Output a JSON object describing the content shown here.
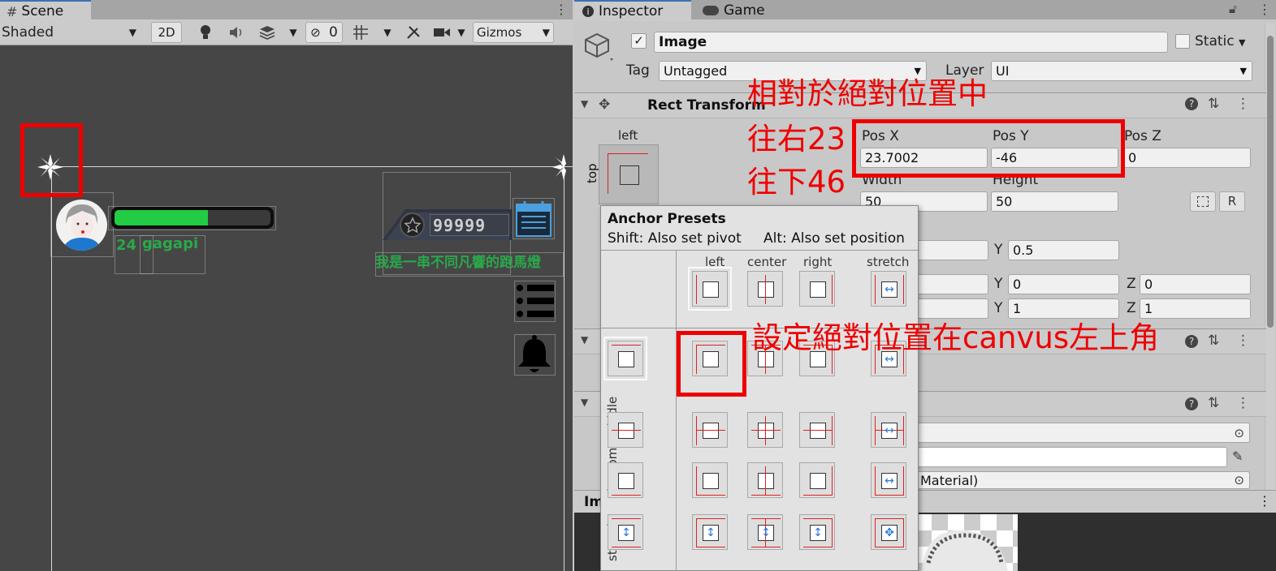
{
  "scene": {
    "tab_label": "Scene",
    "shading_mode": "Shaded",
    "mode_2d": "2D",
    "hidden_count": "0",
    "gizmos_label": "Gizmos",
    "hud": {
      "level": "24",
      "username": "gagapi",
      "coins": "99999",
      "marquee": "我是一串不同凡響的跑馬燈",
      "health_fraction": 0.6
    },
    "icons": [
      "grid-icon",
      "light-bulb-icon",
      "audio-icon",
      "effects-icon",
      "visibility-icon",
      "grid-snap-icon",
      "tools-icon",
      "camera-icon",
      "avatar",
      "star-icon",
      "calendar-icon",
      "list-icon",
      "bell-icon"
    ]
  },
  "inspector": {
    "tab_label": "Inspector",
    "game_tab_label": "Game",
    "object_name": "Image",
    "static_label": "Static",
    "tag_label": "Tag",
    "tag_value": "Untagged",
    "layer_label": "Layer",
    "layer_value": "UI",
    "rect_transform_title": "Rect Transform",
    "anchor_h": "left",
    "anchor_v": "top",
    "pos_x_label": "Pos X",
    "pos_y_label": "Pos Y",
    "pos_z_label": "Pos Z",
    "pos_x": "23.7002",
    "pos_y": "-46",
    "pos_z": "0",
    "width_label": "Width",
    "height_label": "Height",
    "width": "50",
    "height": "50",
    "raw_edit_label": "R",
    "pivot_y_label": "Y",
    "pivot_y": "0.5",
    "rot_y_label": "Y",
    "rot_y": "0",
    "rot_z_label": "Z",
    "rot_z": "0",
    "scale_y_label": "Y",
    "scale_y": "1",
    "scale_z_label": "Z",
    "scale_z": "1",
    "material_value": "Material)",
    "preview_label": "Im"
  },
  "anchor_presets": {
    "title": "Anchor Presets",
    "hint_shift": "Shift: Also set pivot",
    "hint_alt": "Alt: Also set position",
    "columns": [
      "left",
      "center",
      "right",
      "stretch"
    ],
    "rows": [
      "top",
      "middle",
      "bottom",
      "stretch"
    ]
  },
  "annotations": {
    "line1": "相對於絕對位置中",
    "line2": "往右23",
    "line3": "往下46",
    "line4": "設定絕對位置在canvus左上角"
  },
  "colors": {
    "highlight": "#ee0000",
    "health": "#22cc44",
    "hud_text": "#2aa84a",
    "scene_bg": "#464646"
  }
}
